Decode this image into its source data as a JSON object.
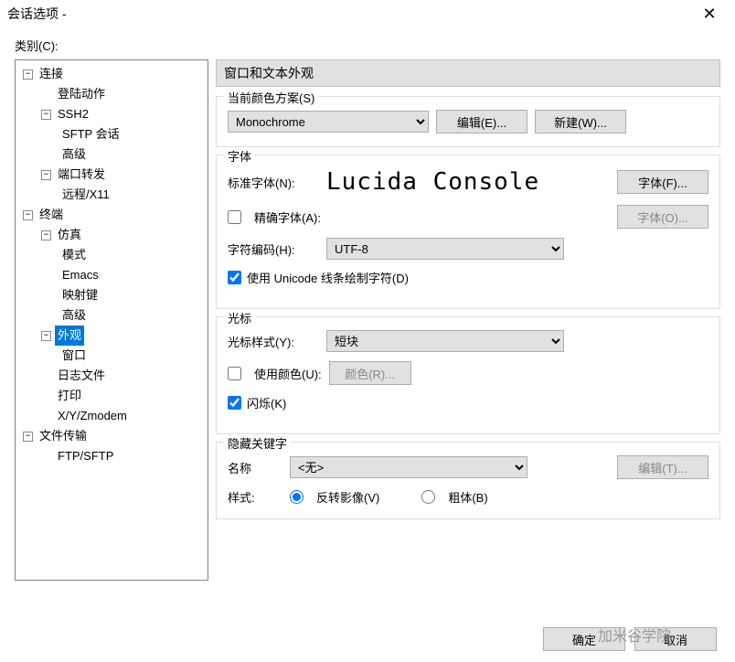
{
  "window": {
    "title": "会话选项 -"
  },
  "category_label": "类别(C):",
  "tree": {
    "connection": "连接",
    "login": "登陆动作",
    "ssh2": "SSH2",
    "sftp_session": "SFTP 会话",
    "advanced": "高级",
    "port_forward": "端口转发",
    "remote_x11": "远程/X11",
    "terminal": "终端",
    "emulation": "仿真",
    "mode": "模式",
    "emacs": "Emacs",
    "map_keys": "映射键",
    "advanced2": "高级",
    "appearance": "外观",
    "window": "窗口",
    "log_file": "日志文件",
    "print": "打印",
    "xyz": "X/Y/Zmodem",
    "file_transfer": "文件传输",
    "ftp_sftp": "FTP/SFTP"
  },
  "header": "窗口和文本外观",
  "scheme": {
    "group": "当前颜色方案(S)",
    "value": "Monochrome",
    "edit": "编辑(E)...",
    "new": "新建(W)..."
  },
  "font": {
    "group": "字体",
    "standard_label": "标准字体(N):",
    "preview": "Lucida Console",
    "font_btn": "字体(F)...",
    "precise_label": "精确字体(A):",
    "font_o_btn": "字体(O)...",
    "encoding_label": "字符编码(H):",
    "encoding_value": "UTF-8",
    "unicode_lines": "使用 Unicode 线条绘制字符(D)"
  },
  "cursor": {
    "group": "光标",
    "style_label": "光标样式(Y):",
    "style_value": "短块",
    "use_color": "使用颜色(U):",
    "color_btn": "颜色(R)...",
    "blink": "闪烁(K)"
  },
  "hidden": {
    "group": "隐藏关键字",
    "name_label": "名称",
    "name_value": "<无>",
    "edit_btn": "编辑(T)...",
    "style_label": "样式:",
    "invert": "反转影像(V)",
    "bold": "粗体(B)"
  },
  "buttons": {
    "ok": "确定",
    "cancel": "取消"
  },
  "watermark": "加米谷学院"
}
